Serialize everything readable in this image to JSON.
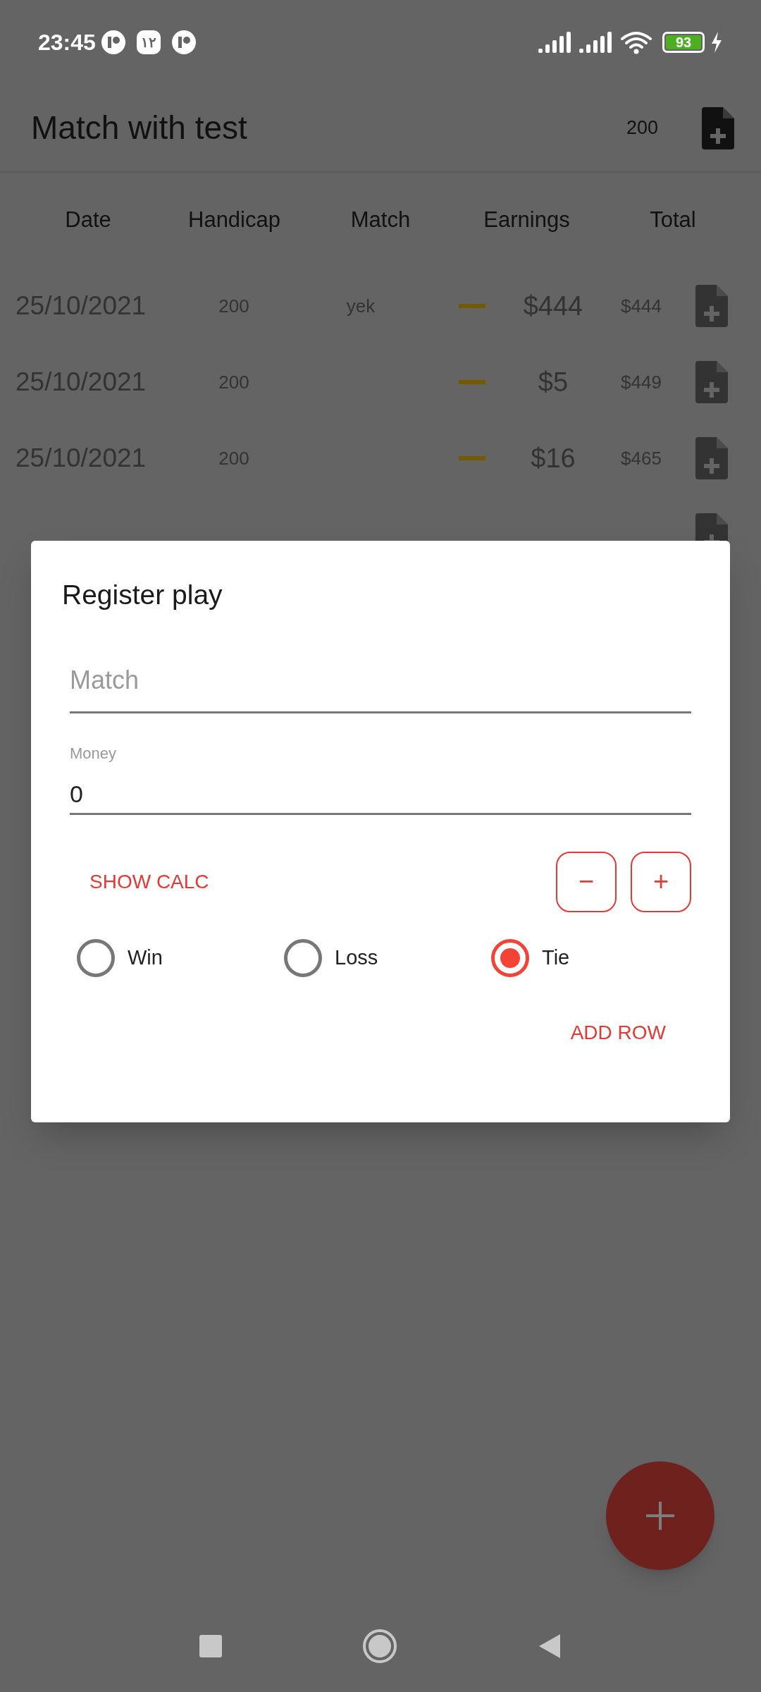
{
  "status_bar": {
    "time": "23:45",
    "notification_badge": "۱۲",
    "battery": "93"
  },
  "app_bar": {
    "title": "Match with test",
    "value": "200"
  },
  "table": {
    "columns": [
      "Date",
      "Handicap",
      "Match",
      "Earnings",
      "Total"
    ],
    "rows": [
      {
        "date": "25/10/2021",
        "handicap": "200",
        "match": "yek",
        "earnings": "$444",
        "total": "$444"
      },
      {
        "date": "25/10/2021",
        "handicap": "200",
        "earnings": "$5",
        "total": "$449"
      },
      {
        "date": "25/10/2021",
        "handicap": "200",
        "earnings": "$16",
        "total": "$465"
      }
    ]
  },
  "dialog": {
    "title": "Register play",
    "match_field": {
      "placeholder": "Match"
    },
    "money_field": {
      "label": "Money",
      "value": "0"
    },
    "show_calc": "SHOW CALC",
    "minus": "−",
    "plus": "+",
    "results": [
      {
        "label": "Win",
        "selected": false
      },
      {
        "label": "Loss",
        "selected": false
      },
      {
        "label": "Tie",
        "selected": true
      }
    ],
    "add_row": "ADD ROW"
  }
}
